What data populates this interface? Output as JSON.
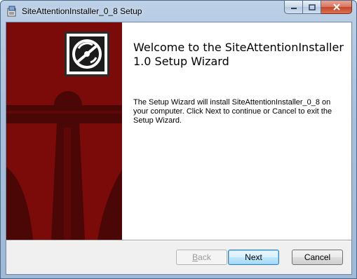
{
  "window": {
    "title": "SiteAttentionInstaller_0_8 Setup"
  },
  "icons": {
    "app": "installer-icon",
    "minimize": "minimize-icon",
    "maximize": "maximize-icon",
    "close": "close-icon",
    "logo": "disc-logo-icon",
    "banner": "anchor-banner-graphic"
  },
  "colors": {
    "banner_red": "#7a0b08",
    "banner_dark": "#4a0705"
  },
  "wizard": {
    "title": "Welcome to the SiteAttentionInstaller 1.0  Setup Wizard",
    "description": "The Setup Wizard will install SiteAttentionInstaller_0_8 on your computer. Click Next to continue or Cancel to exit the Setup Wizard."
  },
  "buttons": {
    "back": {
      "mnemonic": "B",
      "rest": "ack",
      "enabled": false
    },
    "next": "Next",
    "cancel": "Cancel"
  }
}
